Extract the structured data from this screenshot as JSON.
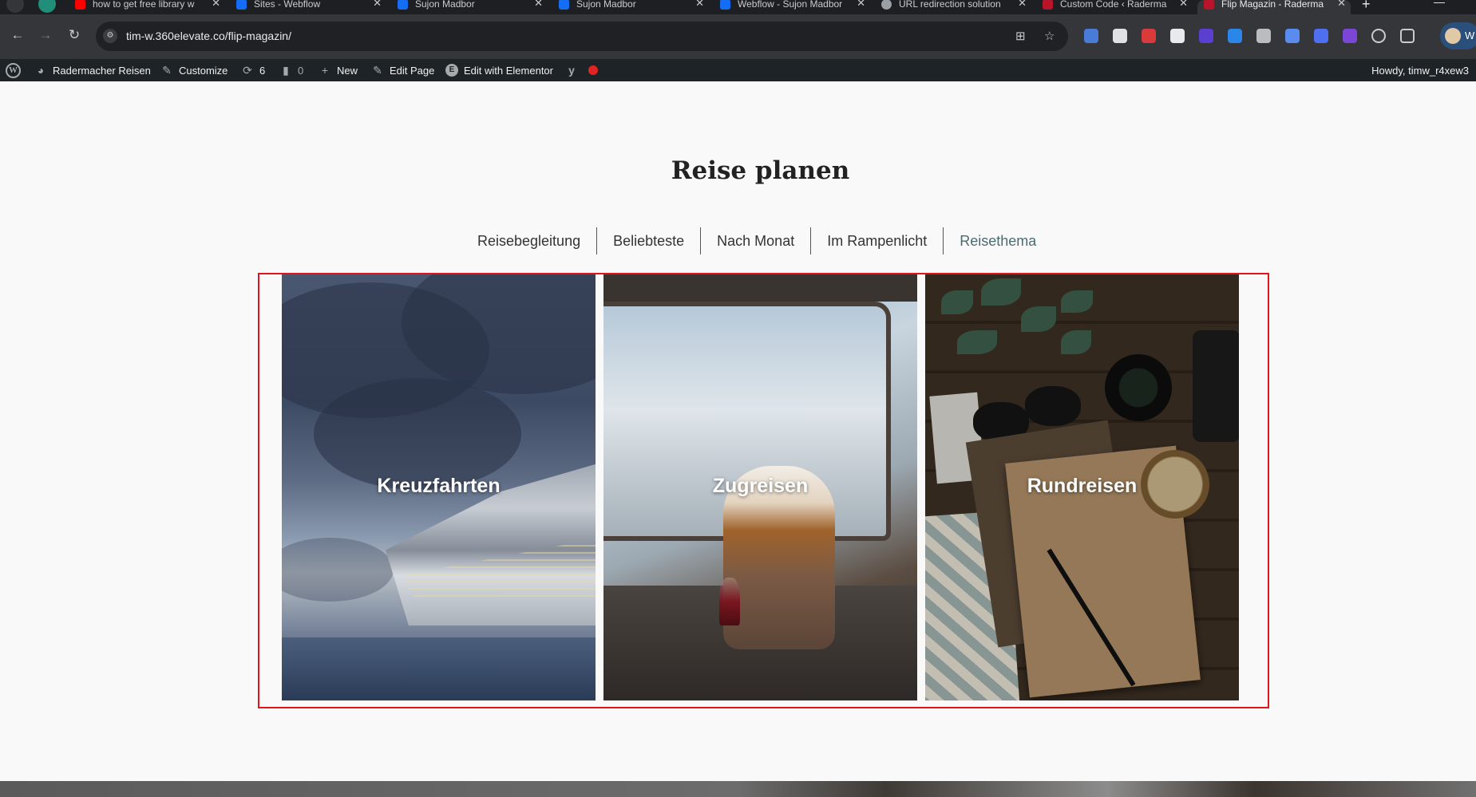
{
  "browser": {
    "tabs": [
      {
        "title": "how to get free library w",
        "favicon_color": "#ff0000"
      },
      {
        "title": "Sites - Webflow",
        "favicon_color": "#146ef5"
      },
      {
        "title": "Sujon Madbor",
        "favicon_color": "#146ef5"
      },
      {
        "title": "Sujon Madbor",
        "favicon_color": "#146ef5"
      },
      {
        "title": "Webflow - Sujon Madbor",
        "favicon_color": "#146ef5"
      },
      {
        "title": "URL redirection solution",
        "favicon_color": "#9aa0a6"
      },
      {
        "title": "Custom Code ‹ Raderma",
        "favicon_color": "#b8142a"
      },
      {
        "title": "Flip Magazin - Raderma",
        "favicon_color": "#b8142a",
        "active": true
      }
    ],
    "new_tab": "+",
    "address": "tim-w.360elevate.co/flip-magazin/",
    "profile_label": "W"
  },
  "admin_bar": {
    "site_name": "Radermacher Reisen",
    "customize": "Customize",
    "updates_count": "6",
    "comments_count": "0",
    "new": "New",
    "edit_page": "Edit Page",
    "edit_elementor": "Edit with Elementor",
    "howdy": "Howdy, timw_r4xew3"
  },
  "main": {
    "heading": "Reise planen",
    "filters": [
      {
        "label": "Reisebegleitung",
        "active": false
      },
      {
        "label": "Beliebteste",
        "active": false
      },
      {
        "label": "Nach Monat",
        "active": false
      },
      {
        "label": "Im Rampenlicht",
        "active": false
      },
      {
        "label": "Reisethema",
        "active": true
      }
    ],
    "cards": [
      {
        "label": "Kreuzfahrten"
      },
      {
        "label": "Zugreisen"
      },
      {
        "label": "Rundreisen"
      }
    ],
    "highlight_color": "#e0141a",
    "active_filter_color": "#4c6b6e"
  }
}
